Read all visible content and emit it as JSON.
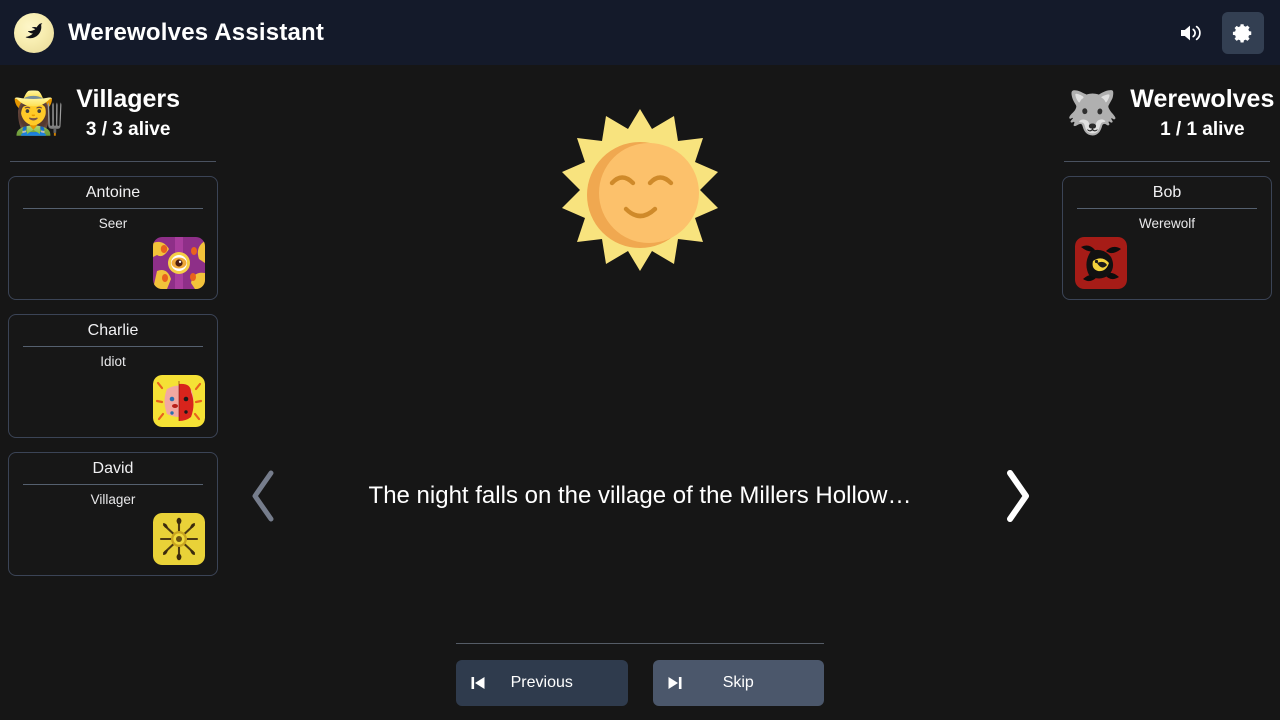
{
  "header": {
    "title": "Werewolves Assistant",
    "logo_icon": "howling-wolf-moon-logo",
    "sound_icon": "volume-on-icon",
    "settings_icon": "gear-icon",
    "bg_color": "#141a2a"
  },
  "teams": {
    "villagers": {
      "emoji": "👩‍🌾",
      "name": "Villagers",
      "alive": "3 / 3 alive",
      "players": [
        {
          "name": "Antoine",
          "role": "Seer",
          "art": "seer-card-art",
          "art_side": "right"
        },
        {
          "name": "Charlie",
          "role": "Idiot",
          "art": "idiot-card-art",
          "art_side": "right"
        },
        {
          "name": "David",
          "role": "Villager",
          "art": "villager-card-art",
          "art_side": "right"
        }
      ]
    },
    "werewolves": {
      "emoji": "🐺",
      "name": "Werewolves",
      "alive": "1 / 1 alive",
      "players": [
        {
          "name": "Bob",
          "role": "Werewolf",
          "art": "werewolf-card-art",
          "art_side": "left"
        }
      ]
    }
  },
  "center": {
    "phase_icon": "smiling-sun-illustration",
    "message": "The night falls on the village of the Millers Hollow…",
    "prev_arrow_icon": "chevron-left-icon",
    "next_arrow_icon": "chevron-right-icon",
    "prev_arrow_state": "disabled",
    "next_arrow_state": "enabled"
  },
  "footer": {
    "previous_label": "Previous",
    "previous_icon": "skip-back-icon",
    "skip_label": "Skip",
    "skip_icon": "skip-forward-icon",
    "previous_color": "#2f3b4d",
    "skip_color": "#4b576b"
  },
  "colors": {
    "background": "#161616",
    "header": "#141a2a",
    "card_border": "#3b4456",
    "divider": "#4a5260",
    "text": "#ffffff"
  }
}
